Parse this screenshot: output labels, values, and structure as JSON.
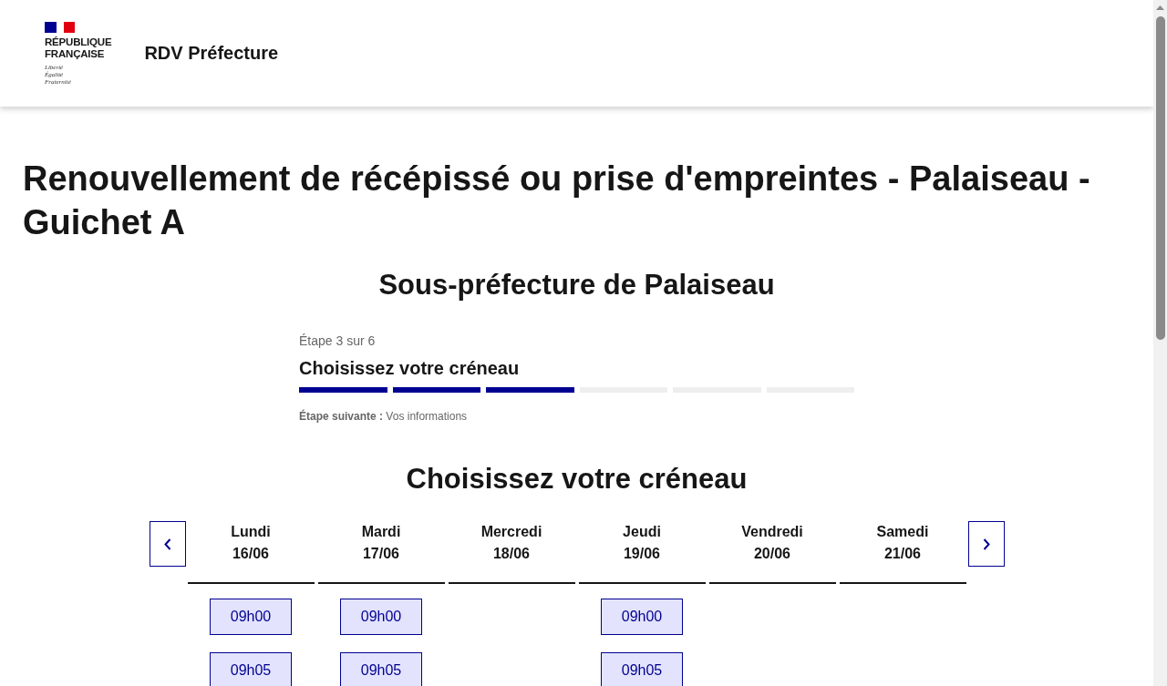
{
  "header": {
    "brand_lines": [
      "RÉPUBLIQUE",
      "FRANÇAISE"
    ],
    "motto": [
      "Liberté",
      "Égalité",
      "Fraternité"
    ],
    "site_name": "RDV Préfecture"
  },
  "title": "Renouvellement de récépissé ou prise d'empreintes - Palaiseau - Guichet A",
  "subtitle": "Sous-préfecture de Palaiseau",
  "stepper": {
    "counter": "Étape 3 sur 6",
    "title": "Choisissez votre créneau",
    "segments": [
      {
        "done": true
      },
      {
        "done": true
      },
      {
        "done": true
      },
      {
        "done": false
      },
      {
        "done": false
      },
      {
        "done": false
      }
    ],
    "next": "**Étape suivante :** Vos informations"
  },
  "calendar": {
    "heading": "Choisissez votre créneau",
    "days": [
      {
        "name": "Lundi",
        "date": "16/06",
        "slots": [
          "09h00",
          "09h05"
        ]
      },
      {
        "name": "Mardi",
        "date": "17/06",
        "slots": [
          "09h00",
          "09h05"
        ]
      },
      {
        "name": "Mercredi",
        "date": "18/06"
      },
      {
        "name": "Jeudi",
        "date": "19/06",
        "slots": [
          "09h00",
          "09h05"
        ]
      },
      {
        "name": "Vendredi",
        "date": "20/06"
      },
      {
        "name": "Samedi",
        "date": "21/06"
      }
    ]
  }
}
